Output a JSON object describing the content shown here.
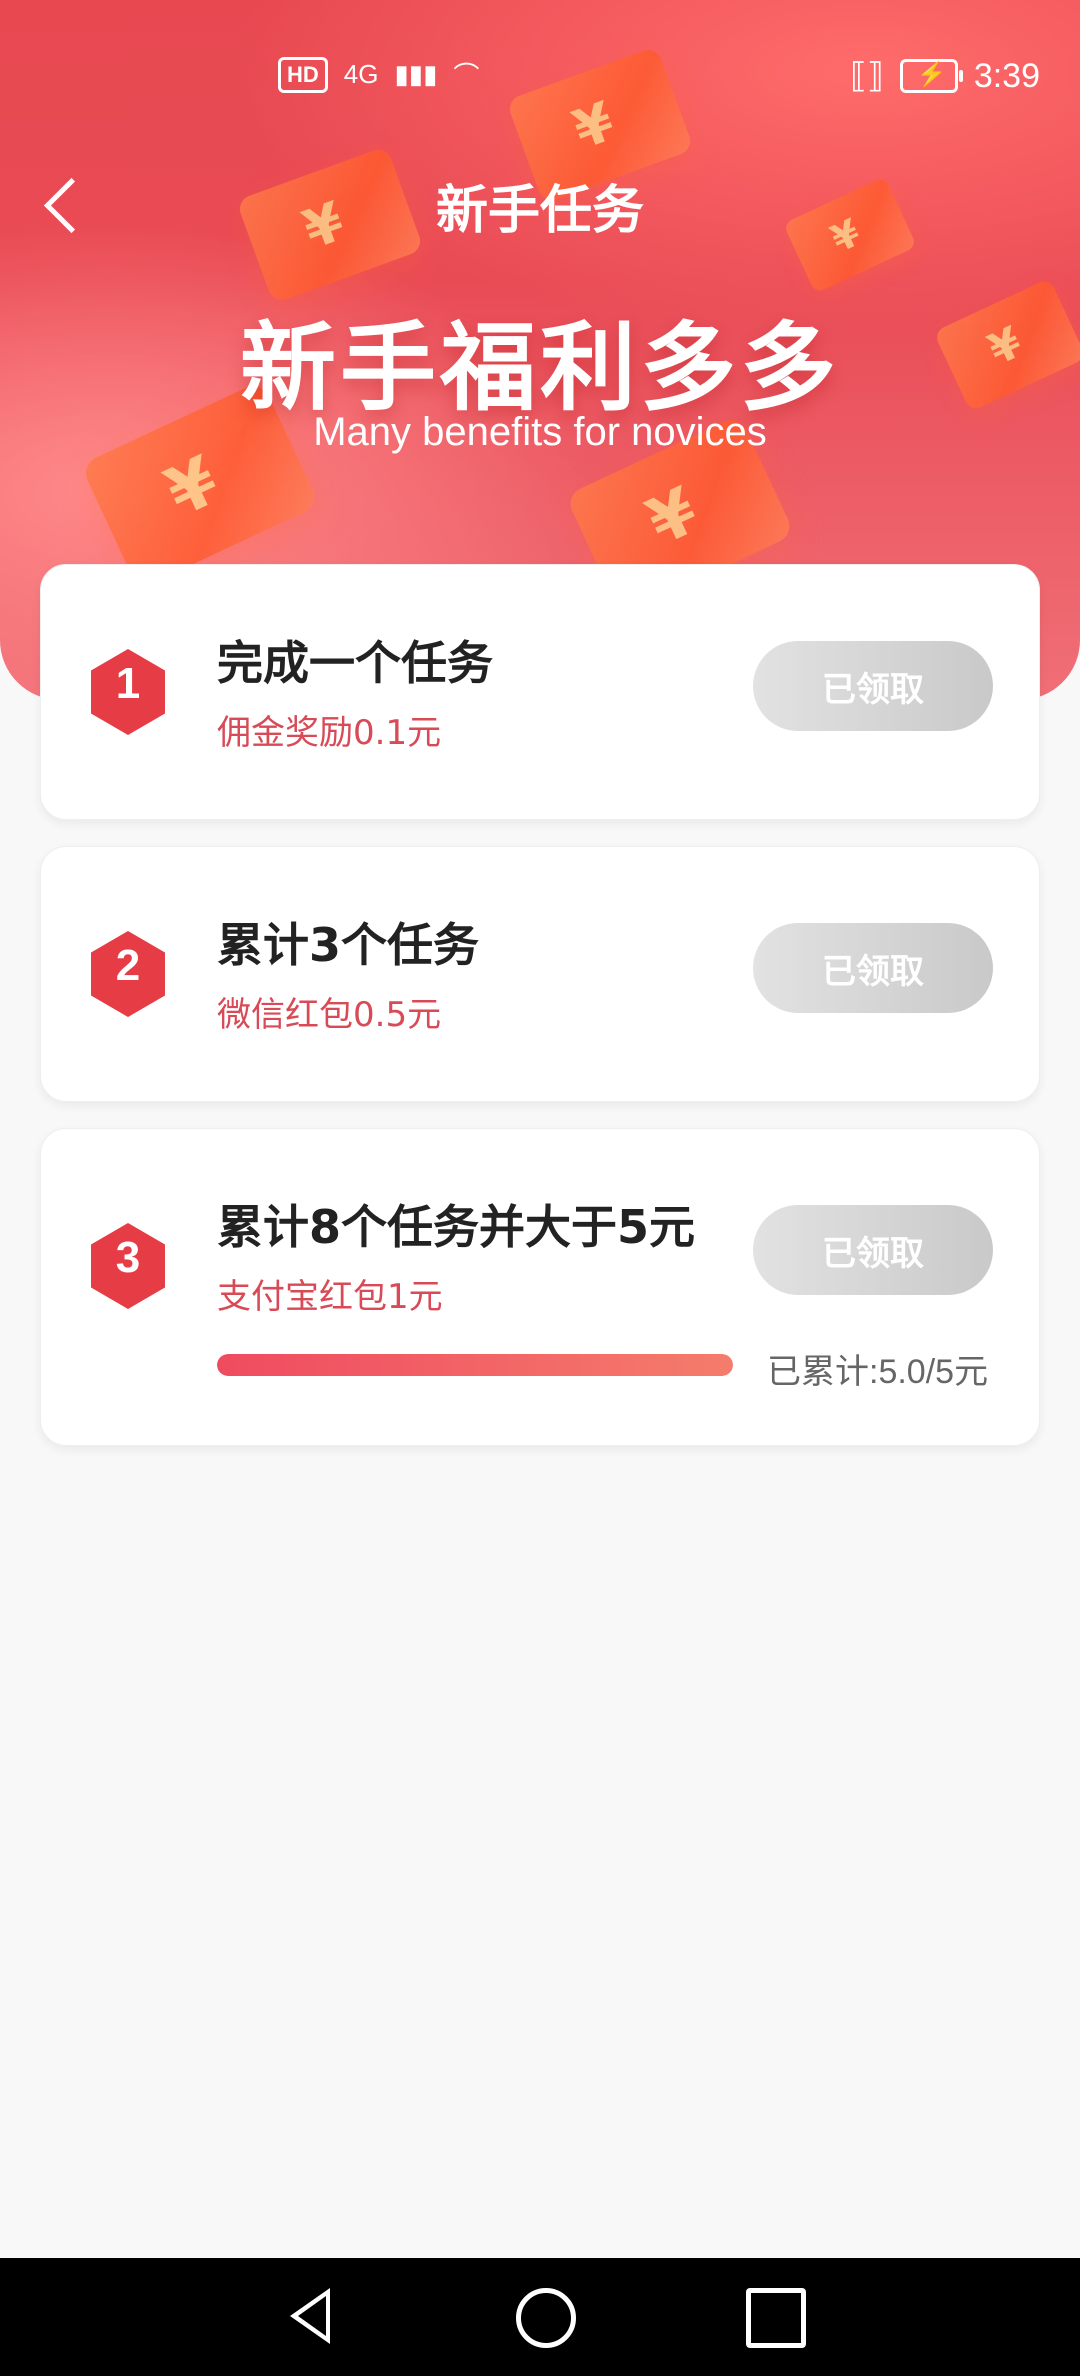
{
  "status_bar": {
    "left": {
      "hd": "HD",
      "network": "4G"
    },
    "time": "3:39",
    "icons": [
      "vibrate-icon",
      "battery-charging-icon",
      "wifi-icon",
      "signal-icon"
    ]
  },
  "nav": {
    "title": "新手任务"
  },
  "hero": {
    "headline": "新手福利多多",
    "subhead": "Many benefits for novices"
  },
  "tasks": [
    {
      "number": "1",
      "title": "完成一个任务",
      "reward": "佣金奖励0.1元",
      "button": "已领取"
    },
    {
      "number": "2",
      "title": "累计3个任务",
      "reward": "微信红包0.5元",
      "button": "已领取"
    },
    {
      "number": "3",
      "title": "累计8个任务并大于5元",
      "reward": "支付宝红包1元",
      "button": "已领取",
      "progress": {
        "text": "已累计:5.0/5元",
        "value": 1.0
      }
    }
  ],
  "colors": {
    "accent": "#e53c45",
    "reward": "#d84a56",
    "disabled_button_start": "#e2e2e2",
    "disabled_button_end": "#c9c9c9"
  }
}
